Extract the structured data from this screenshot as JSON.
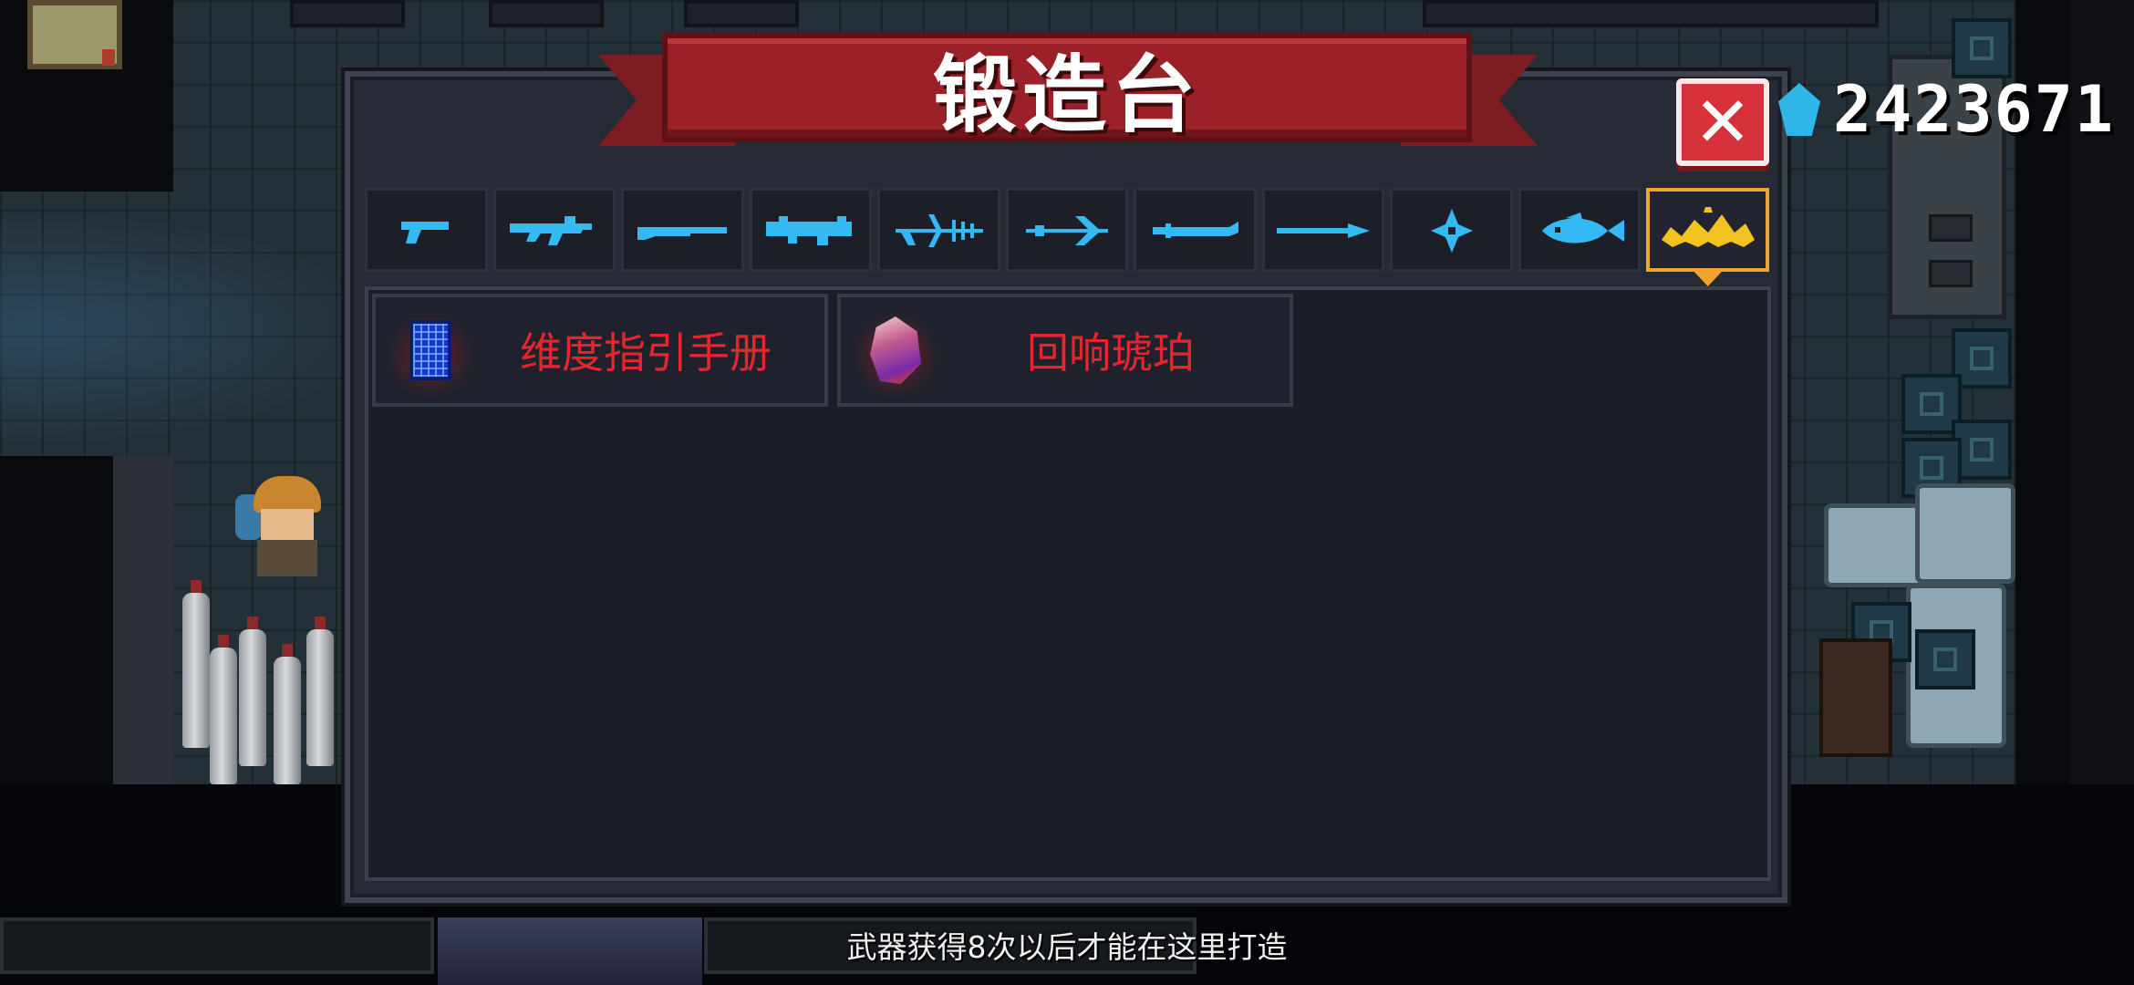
{
  "dialog": {
    "title": "锻造台",
    "close_label": "✕"
  },
  "currency": {
    "icon": "gem-icon",
    "value": "2423671",
    "color": "#2fb6e8"
  },
  "tabs": [
    {
      "name": "pistol",
      "icon": "pistol-icon",
      "active": false
    },
    {
      "name": "rifle",
      "icon": "rifle-icon",
      "active": false
    },
    {
      "name": "shotgun",
      "icon": "shotgun-icon",
      "active": false
    },
    {
      "name": "launcher",
      "icon": "launcher-icon",
      "active": false
    },
    {
      "name": "crossbow",
      "icon": "crossbow-icon",
      "active": false
    },
    {
      "name": "bow",
      "icon": "bow-icon",
      "active": false
    },
    {
      "name": "sword",
      "icon": "sword-icon",
      "active": false
    },
    {
      "name": "spear",
      "icon": "spear-icon",
      "active": false
    },
    {
      "name": "shuriken",
      "icon": "shuriken-icon",
      "active": false
    },
    {
      "name": "fish",
      "icon": "fish-icon",
      "active": false
    },
    {
      "name": "special",
      "icon": "crown-icon",
      "active": true
    }
  ],
  "items": [
    {
      "label": "维度指引手册",
      "icon": "manual-icon"
    },
    {
      "label": "回响琥珀",
      "icon": "amber-icon"
    }
  ],
  "hint": "武器获得8次以后才能在这里打造",
  "colors": {
    "tab_icon": "#35b9f2",
    "active_tab_border": "#f0a531",
    "item_label": "#e8252e",
    "banner": "#9c2027",
    "close_button": "#d6303b"
  }
}
